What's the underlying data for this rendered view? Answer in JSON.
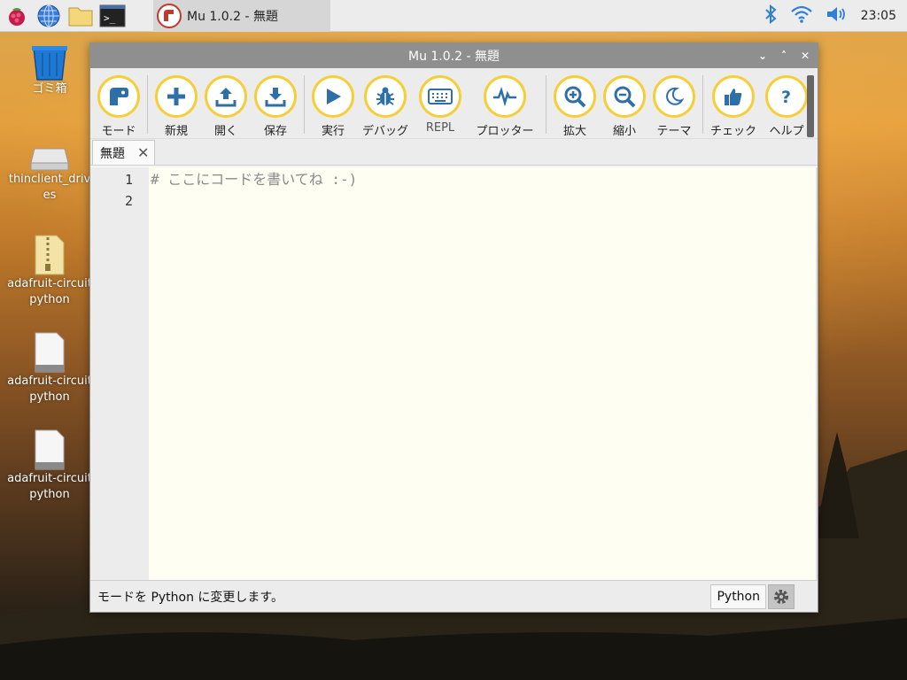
{
  "taskbar": {
    "task_title": "Mu 1.0.2 - 無題",
    "clock": "23:05",
    "icons": [
      "raspberry-menu-icon",
      "web-browser-icon",
      "file-manager-icon",
      "terminal-icon",
      "bluetooth-icon",
      "wifi-icon",
      "volume-icon"
    ]
  },
  "desktop": {
    "items": [
      {
        "label": "ゴミ箱",
        "icon": "trash-icon"
      },
      {
        "label": "thinclient_drives",
        "icon": "drive-icon"
      },
      {
        "label": "adafruit-circuitpython",
        "icon": "zip-file-icon"
      },
      {
        "label": "adafruit-circuitpython",
        "icon": "file-icon"
      },
      {
        "label": "adafruit-circuitpython",
        "icon": "file-icon"
      }
    ]
  },
  "window": {
    "title": "Mu 1.0.2 - 無題",
    "controls": {
      "minimize": "⌄",
      "maximize": "˄",
      "close": "✕"
    }
  },
  "toolbar": {
    "buttons": [
      {
        "label": "モード",
        "icon": "mode-icon"
      },
      {
        "label": "新規",
        "icon": "plus-icon"
      },
      {
        "label": "開く",
        "icon": "upload-icon"
      },
      {
        "label": "保存",
        "icon": "download-icon"
      },
      {
        "label": "実行",
        "icon": "play-icon"
      },
      {
        "label": "デバッグ",
        "icon": "bug-icon"
      },
      {
        "label": "REPL",
        "icon": "keyboard-icon"
      },
      {
        "label": "プロッター",
        "icon": "pulse-icon"
      },
      {
        "label": "拡大",
        "icon": "zoom-in-icon"
      },
      {
        "label": "縮小",
        "icon": "zoom-out-icon"
      },
      {
        "label": "テーマ",
        "icon": "moon-icon"
      },
      {
        "label": "チェック",
        "icon": "thumbs-up-icon"
      },
      {
        "label": "ヘルプ",
        "icon": "help-icon"
      }
    ]
  },
  "tabs": [
    {
      "label": "無題",
      "close": "✕"
    }
  ],
  "editor": {
    "lines": [
      "# ここにコードを書いてね :-)",
      ""
    ],
    "line_numbers": [
      "1",
      "2"
    ]
  },
  "status": {
    "message": "モードを Python に変更します。",
    "mode": "Python"
  },
  "colors": {
    "accent": "#f5cf3a",
    "icon": "#2f6fa8",
    "titlebar": "#8f8f8f",
    "editor_bg": "#fffef2"
  }
}
